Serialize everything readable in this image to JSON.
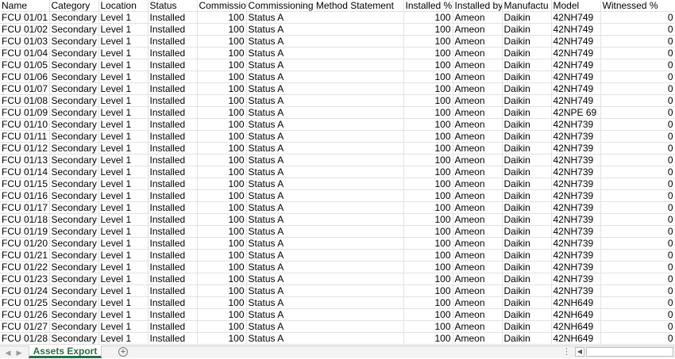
{
  "sheet": {
    "columns": [
      {
        "key": "name",
        "label": "Name",
        "width": 62,
        "numeric": false
      },
      {
        "key": "category",
        "label": "Category",
        "width": 62,
        "numeric": false
      },
      {
        "key": "location",
        "label": "Location",
        "width": 62,
        "numeric": false
      },
      {
        "key": "status",
        "label": "Status",
        "width": 62,
        "numeric": false
      },
      {
        "key": "commissioned",
        "label": "Commissio",
        "width": 62,
        "numeric": true
      },
      {
        "key": "method",
        "label": "Commissioning Method Statement",
        "width": 198,
        "numeric": false
      },
      {
        "key": "installed_pct",
        "label": "Installed %",
        "width": 62,
        "numeric": true
      },
      {
        "key": "installed_by",
        "label": "Installed by",
        "width": 62,
        "numeric": false
      },
      {
        "key": "manufacturer",
        "label": "Manufactu",
        "width": 62,
        "numeric": false
      },
      {
        "key": "model",
        "label": "Model",
        "width": 62,
        "numeric": false
      },
      {
        "key": "witnessed_pct",
        "label": "Witnessed %",
        "width": 94,
        "numeric": true
      }
    ],
    "rows": [
      [
        "FCU 01/01",
        "Secondary",
        "Level 1",
        "Installed",
        "100",
        "Status A",
        "100",
        "Ameon",
        "Daikin",
        "42NH749",
        "0"
      ],
      [
        "FCU 01/02",
        "Secondary",
        "Level 1",
        "Installed",
        "100",
        "Status A",
        "100",
        "Ameon",
        "Daikin",
        "42NH749",
        "0"
      ],
      [
        "FCU 01/03",
        "Secondary",
        "Level 1",
        "Installed",
        "100",
        "Status A",
        "100",
        "Ameon",
        "Daikin",
        "42NH749",
        "0"
      ],
      [
        "FCU 01/04",
        "Secondary",
        "Level 1",
        "Installed",
        "100",
        "Status A",
        "100",
        "Ameon",
        "Daikin",
        "42NH749",
        "0"
      ],
      [
        "FCU 01/05",
        "Secondary",
        "Level 1",
        "Installed",
        "100",
        "Status A",
        "100",
        "Ameon",
        "Daikin",
        "42NH749",
        "0"
      ],
      [
        "FCU 01/06",
        "Secondary",
        "Level 1",
        "Installed",
        "100",
        "Status A",
        "100",
        "Ameon",
        "Daikin",
        "42NH749",
        "0"
      ],
      [
        "FCU 01/07",
        "Secondary",
        "Level 1",
        "Installed",
        "100",
        "Status A",
        "100",
        "Ameon",
        "Daikin",
        "42NH749",
        "0"
      ],
      [
        "FCU 01/08",
        "Secondary",
        "Level 1",
        "Installed",
        "100",
        "Status A",
        "100",
        "Ameon",
        "Daikin",
        "42NH749",
        "0"
      ],
      [
        "FCU 01/09",
        "Secondary",
        "Level 1",
        "Installed",
        "100",
        "Status A",
        "100",
        "Ameon",
        "Daikin",
        "42NPE 69",
        "0"
      ],
      [
        "FCU 01/10",
        "Secondary",
        "Level 1",
        "Installed",
        "100",
        "Status A",
        "100",
        "Ameon",
        "Daikin",
        "42NH739",
        "0"
      ],
      [
        "FCU 01/11",
        "Secondary",
        "Level 1",
        "Installed",
        "100",
        "Status A",
        "100",
        "Ameon",
        "Daikin",
        "42NH739",
        "0"
      ],
      [
        "FCU 01/12",
        "Secondary",
        "Level 1",
        "Installed",
        "100",
        "Status A",
        "100",
        "Ameon",
        "Daikin",
        "42NH739",
        "0"
      ],
      [
        "FCU 01/13",
        "Secondary",
        "Level 1",
        "Installed",
        "100",
        "Status A",
        "100",
        "Ameon",
        "Daikin",
        "42NH739",
        "0"
      ],
      [
        "FCU 01/14",
        "Secondary",
        "Level 1",
        "Installed",
        "100",
        "Status A",
        "100",
        "Ameon",
        "Daikin",
        "42NH739",
        "0"
      ],
      [
        "FCU 01/15",
        "Secondary",
        "Level 1",
        "Installed",
        "100",
        "Status A",
        "100",
        "Ameon",
        "Daikin",
        "42NH739",
        "0"
      ],
      [
        "FCU 01/16",
        "Secondary",
        "Level 1",
        "Installed",
        "100",
        "Status A",
        "100",
        "Ameon",
        "Daikin",
        "42NH739",
        "0"
      ],
      [
        "FCU 01/17",
        "Secondary",
        "Level 1",
        "Installed",
        "100",
        "Status A",
        "100",
        "Ameon",
        "Daikin",
        "42NH739",
        "0"
      ],
      [
        "FCU 01/18",
        "Secondary",
        "Level 1",
        "Installed",
        "100",
        "Status A",
        "100",
        "Ameon",
        "Daikin",
        "42NH739",
        "0"
      ],
      [
        "FCU 01/19",
        "Secondary",
        "Level 1",
        "Installed",
        "100",
        "Status A",
        "100",
        "Ameon",
        "Daikin",
        "42NH739",
        "0"
      ],
      [
        "FCU 01/20",
        "Secondary",
        "Level 1",
        "Installed",
        "100",
        "Status A",
        "100",
        "Ameon",
        "Daikin",
        "42NH739",
        "0"
      ],
      [
        "FCU 01/21",
        "Secondary",
        "Level 1",
        "Installed",
        "100",
        "Status A",
        "100",
        "Ameon",
        "Daikin",
        "42NH739",
        "0"
      ],
      [
        "FCU 01/22",
        "Secondary",
        "Level 1",
        "Installed",
        "100",
        "Status A",
        "100",
        "Ameon",
        "Daikin",
        "42NH739",
        "0"
      ],
      [
        "FCU 01/23",
        "Secondary",
        "Level 1",
        "Installed",
        "100",
        "Status A",
        "100",
        "Ameon",
        "Daikin",
        "42NH739",
        "0"
      ],
      [
        "FCU 01/24",
        "Secondary",
        "Level 1",
        "Installed",
        "100",
        "Status A",
        "100",
        "Ameon",
        "Daikin",
        "42NH739",
        "0"
      ],
      [
        "FCU 01/25",
        "Secondary",
        "Level 1",
        "Installed",
        "100",
        "Status A",
        "100",
        "Ameon",
        "Daikin",
        "42NH649",
        "0"
      ],
      [
        "FCU 01/26",
        "Secondary",
        "Level 1",
        "Installed",
        "100",
        "Status A",
        "100",
        "Ameon",
        "Daikin",
        "42NH649",
        "0"
      ],
      [
        "FCU 01/27",
        "Secondary",
        "Level 1",
        "Installed",
        "100",
        "Status A",
        "100",
        "Ameon",
        "Daikin",
        "42NH649",
        "0"
      ],
      [
        "FCU 01/28",
        "Secondary",
        "Level 1",
        "Installed",
        "100",
        "Status A",
        "100",
        "Ameon",
        "Daikin",
        "42NH649",
        "0"
      ]
    ]
  },
  "tabbar": {
    "active_tab": "Assets Export",
    "accent_color": "#217346",
    "prev_icon": "triangle-left-icon",
    "add_icon": "plus-circle-icon",
    "dots": "⋮",
    "scroll_left_icon": "scroll-left-icon"
  }
}
